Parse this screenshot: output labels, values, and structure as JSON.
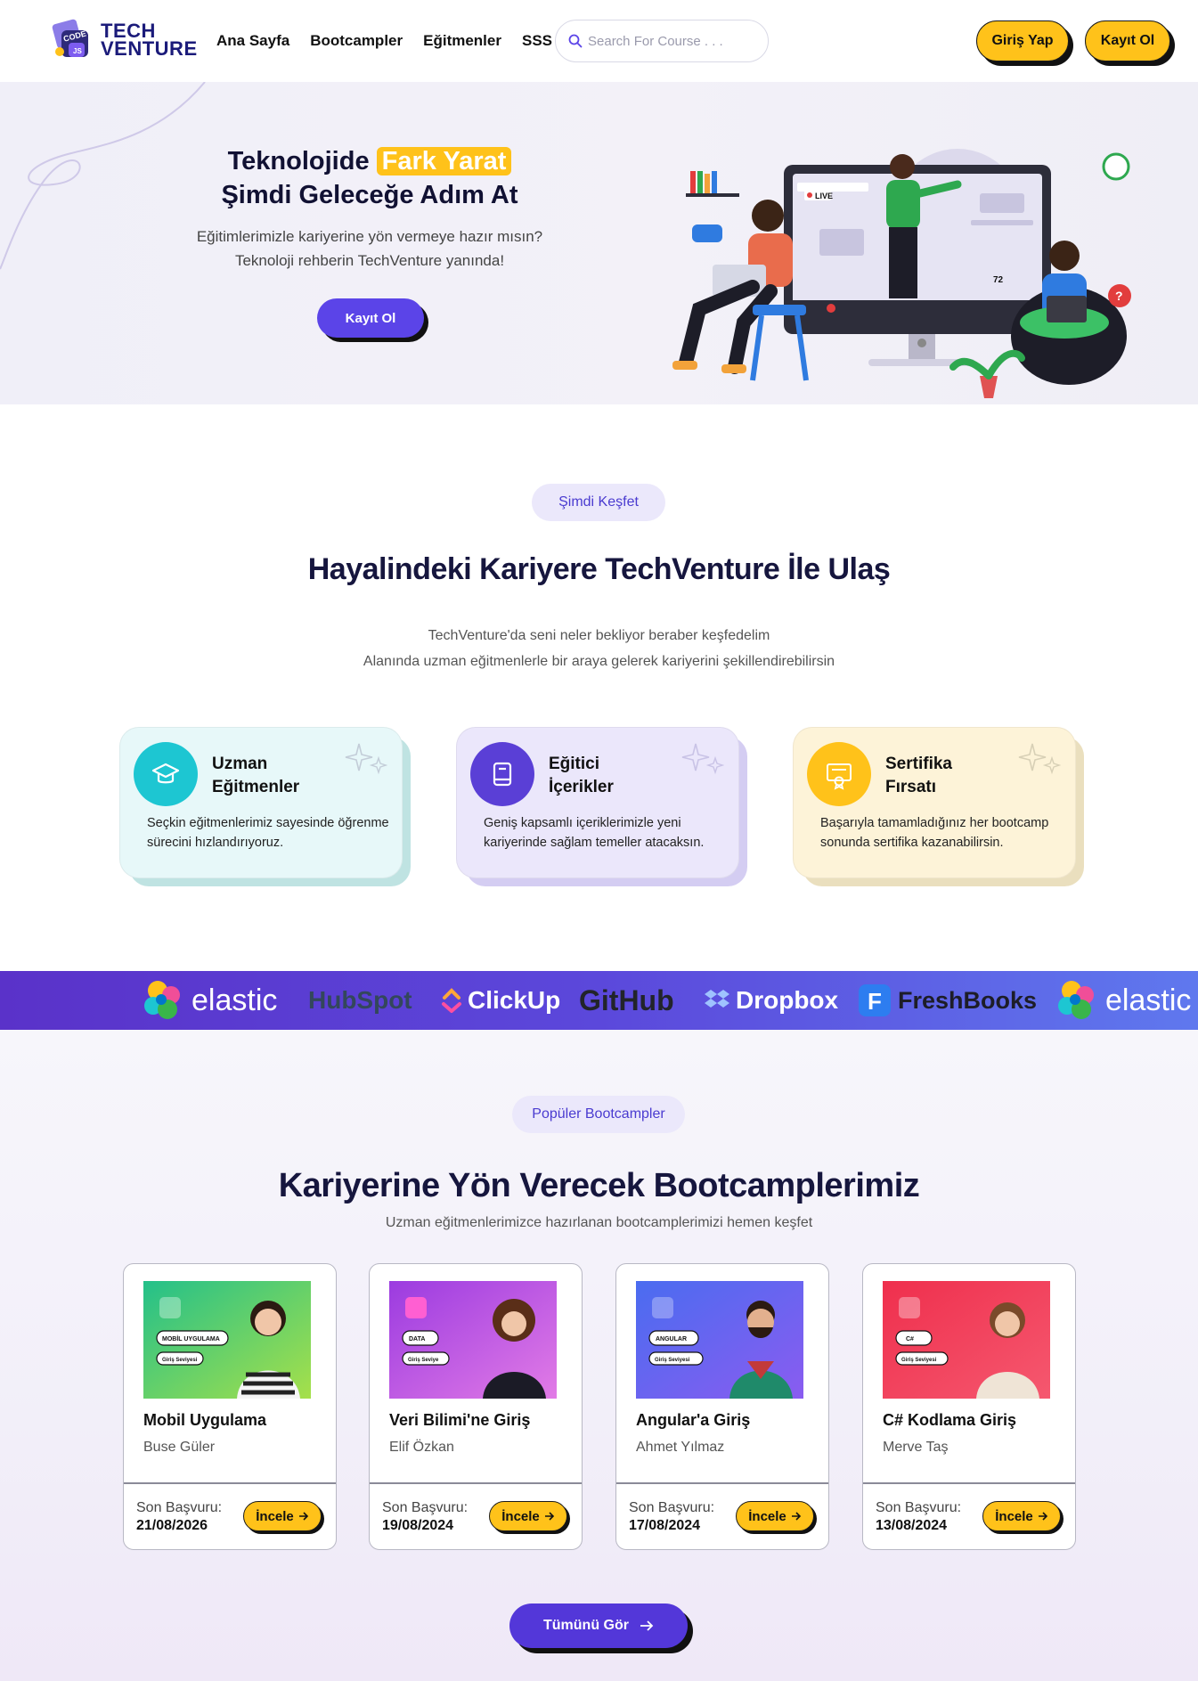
{
  "brand": {
    "line1": "TECH",
    "line2": "VENTURE",
    "badge": "CODE"
  },
  "nav": [
    {
      "label": "Ana Sayfa"
    },
    {
      "label": "Bootcampler"
    },
    {
      "label": "Eğitmenler"
    },
    {
      "label": "SSS"
    }
  ],
  "search": {
    "placeholder": "Search For Course . . ."
  },
  "header_buttons": {
    "login": "Giriş Yap",
    "signup": "Kayıt Ol"
  },
  "hero": {
    "title_pre": "Teknolojide",
    "title_highlight": "Fark Yarat",
    "title_line2": "Şimdi Geleceğe Adım At",
    "subtitle_line1": "Eğitimlerimizle kariyerine yön vermeye hazır mısın?",
    "subtitle_line2": "Teknoloji rehberin TechVenture yanında!",
    "cta": "Kayıt Ol",
    "live_label": "LIVE",
    "viewer_count": "72"
  },
  "discover": {
    "pill": "Şimdi Keşfet",
    "title": "Hayalindeki Kariyere TechVenture İle Ulaş",
    "sub_line1": "TechVenture'da seni neler bekliyor beraber keşfedelim",
    "sub_line2": "Alanında uzman eğitmenlerle bir araya gelerek kariyerini şekillendirebilirsin"
  },
  "features": [
    {
      "title_line1": "Uzman",
      "title_line2": "Eğitmenler",
      "desc": "Seçkin eğitmenlerimiz sayesinde öğrenme sürecini hızlandırıyoruz.",
      "icon": "graduation-cap-icon",
      "color": "#1dc6d2"
    },
    {
      "title_line1": "Eğitici",
      "title_line2": "İçerikler",
      "desc": "Geniş kapsamlı içeriklerimizle yeni kariyerinde sağlam temeller atacaksın.",
      "icon": "book-icon",
      "color": "#5a3fd6"
    },
    {
      "title_line1": "Sertifika",
      "title_line2": "Fırsatı",
      "desc": "Başarıyla tamamladığınız her bootcamp sonunda sertifika kazanabilirsin.",
      "icon": "certificate-icon",
      "color": "#ffc21a"
    }
  ],
  "partners": [
    "elastic",
    "HubSpot",
    "ClickUp",
    "GitHub",
    "Dropbox",
    "FreshBooks",
    "elastic"
  ],
  "bootcamps_section": {
    "pill": "Popüler Bootcampler",
    "title": "Kariyerine Yön Verecek Bootcamplerimiz",
    "subtitle": "Uzman eğitmenlerimizce hazırlanan bootcamplerimizi hemen keşfet",
    "deadline_label": "Son Başvuru:",
    "button": "İncele",
    "see_all": "Tümünü Gör"
  },
  "bootcamps": [
    {
      "title": "Mobil Uygulama",
      "author": "Buse Güler",
      "date": "21/08/2026",
      "tag": "MOBİL UYGULAMA",
      "level": "Giriş Seviyesi",
      "color1": "#23c08a",
      "color2": "#a6e04a"
    },
    {
      "title": "Veri Bilimi'ne Giriş",
      "author": "Elif Özkan",
      "date": "19/08/2024",
      "tag": "DATA",
      "level": "Giriş Seviye",
      "color1": "#9b3be0",
      "color2": "#e27be6"
    },
    {
      "title": "Angular'a Giriş",
      "author": "Ahmet Yılmaz",
      "date": "17/08/2024",
      "tag": "ANGULAR",
      "level": "Giriş Seviyesi",
      "color1": "#4a6cf0",
      "color2": "#8a5cf0"
    },
    {
      "title": "C# Kodlama Giriş",
      "author": "Merve Taş",
      "date": "13/08/2024",
      "tag": "C#",
      "level": "Giriş Seviyesi",
      "color1": "#ef2f4d",
      "color2": "#f5586f"
    }
  ]
}
